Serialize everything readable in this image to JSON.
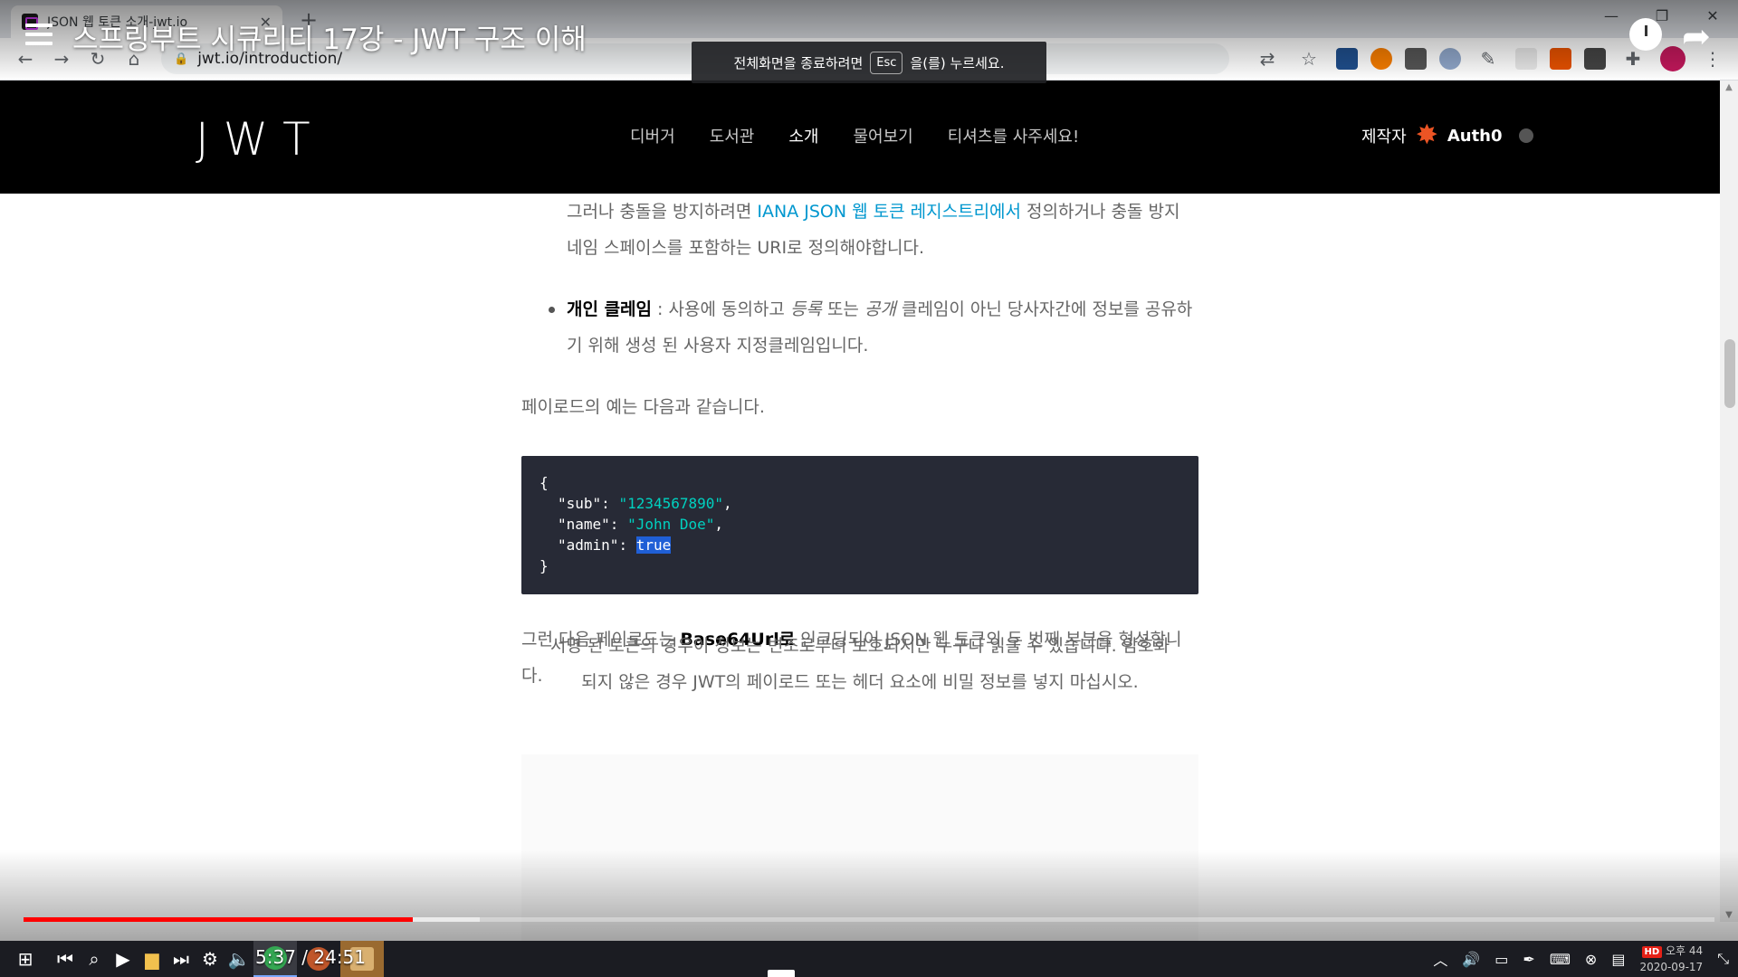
{
  "browser": {
    "tab_title": "JSON 웹 토큰 소개-jwt.io",
    "tab_close": "✕",
    "new_tab": "+",
    "url": "jwt.io/introduction/",
    "window_buttons": [
      "—",
      "❐",
      "✕"
    ]
  },
  "video": {
    "title": "스프링부트 시큐리티 17강 - JWT 구조 이해",
    "time": "5:37 / 24:51",
    "progress_played": 0.23,
    "progress_buffered": 0.27
  },
  "fullscreen_banner": {
    "before": "전체화면을 종료하려면",
    "key": "Esc",
    "after": "을(를) 누르세요."
  },
  "site": {
    "logo": "JWT",
    "nav": [
      "디버거",
      "도서관",
      "소개",
      "물어보기",
      "티셔츠를 사주세요!"
    ],
    "active_nav": "소개",
    "maker_label": "제작자",
    "maker_name": "Auth0"
  },
  "article": {
    "p1_before": "그러나 충돌을 방지하려면 ",
    "p1_link": "IANA JSON 웹 토큰 레지스트리에서",
    "p1_after": " 정의하거나 충돌 방지 네임 스페이스를 포함하는 URI로 정의해야합니다.",
    "bullet_bold": "개인 클레임",
    "bullet_a": " : 사용에 동의하고 ",
    "bullet_i1": "등록",
    "bullet_b": " 또는 ",
    "bullet_i2": "공개",
    "bullet_c": " 클레임이 아닌 당사자간에 정보를 공유하기 위해 생성 된 사용자 지정클레임입니다.",
    "p2": "페이로드의 예는 다음과 같습니다.",
    "code": {
      "open": "{",
      "close": "}",
      "k1": "\"sub\"",
      "v1": "\"1234567890\"",
      "k2": "\"name\"",
      "v2": "\"John Doe\"",
      "k3": "\"admin\"",
      "v3": "true",
      "colon": ": ",
      "comma": ","
    },
    "p3_before": "그런 다음 페이로드는 ",
    "p3_bold": "Base64Url로",
    "p3_after": " 인코딩되어 JSON 웹 토큰의 두 번째 부분을 형성합니다.",
    "note": "서명 된 토큰의 경우이 정보는 변조로부터 보호되지만 누구나 읽을 수 있습니다. 암호화되지 않은 경우 JWT의 페이로드 또는 헤더 요소에 비밀 정보를 넣지 마십시오."
  },
  "tray": {
    "time_partial": "오후 44",
    "date": "2020-09-17",
    "hd": "HD"
  },
  "colors": {
    "header_bg": "#000000",
    "link": "#0097cf",
    "code_bg": "#272a36",
    "code_string": "#00d1c0",
    "progress": "#ff0000",
    "auth0": "#eb5424"
  }
}
